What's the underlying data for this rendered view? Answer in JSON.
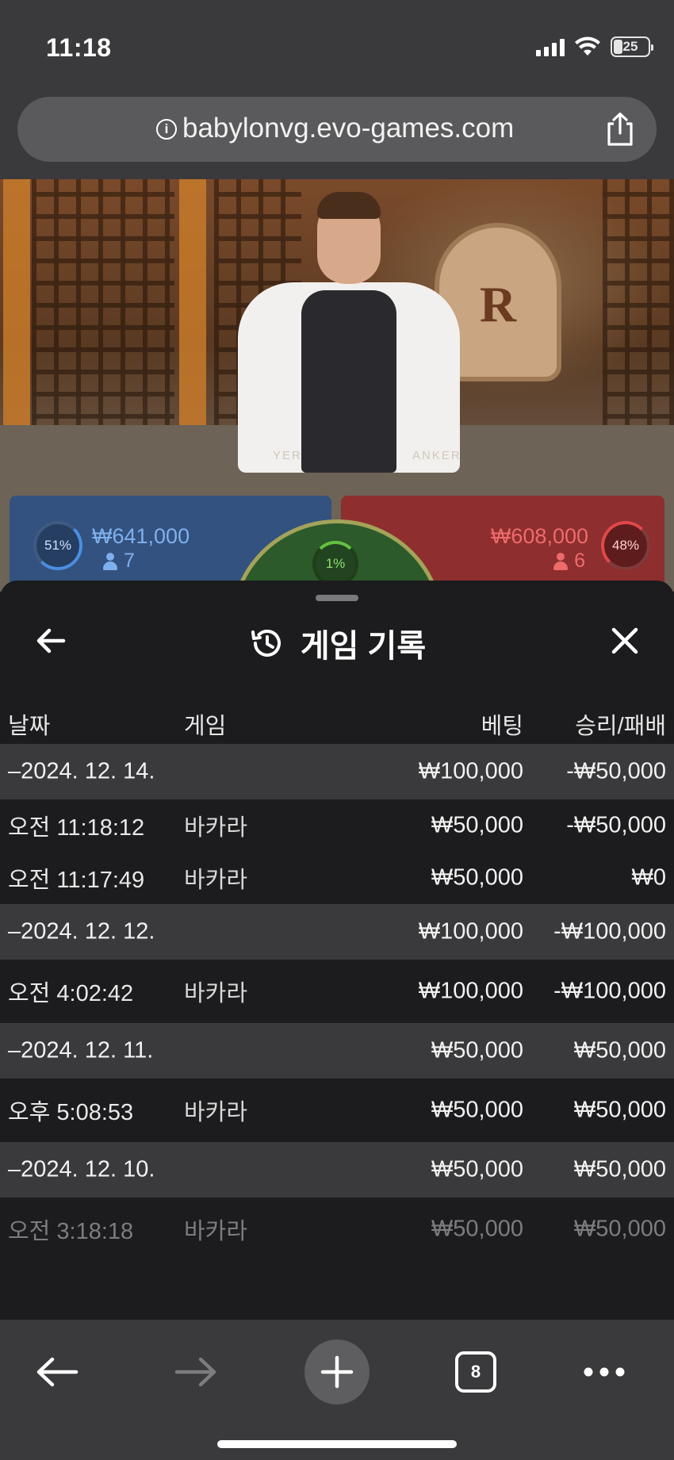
{
  "status_bar": {
    "time": "11:18",
    "battery_level": "25"
  },
  "browser": {
    "url": "babylonvg.evo-games.com",
    "open_tabs": "8"
  },
  "video": {
    "table_text_player": "YER",
    "table_text_banker": "ANKER"
  },
  "bets": {
    "player": {
      "percent": "51%",
      "amount": "₩641,000",
      "players": "7",
      "color": "#33527f"
    },
    "tie": {
      "percent": "1%",
      "color": "#2d5a2a"
    },
    "banker": {
      "percent": "48%",
      "amount": "₩608,000",
      "players": "6",
      "color": "#8e2e2e"
    }
  },
  "history": {
    "title": "게임 기록",
    "columns": {
      "date": "날짜",
      "game": "게임",
      "bet": "베팅",
      "result": "승리/패배"
    },
    "rows": [
      {
        "date": "–2024. 12. 14.",
        "game": "",
        "bet": "₩100,000",
        "result": "-₩50,000"
      },
      {
        "date": "오전 11:18:12",
        "game": "바카라",
        "bet": "₩50,000",
        "result": "-₩50,000"
      },
      {
        "date": "오전 11:17:49",
        "game": "바카라",
        "bet": "₩50,000",
        "result": "₩0"
      },
      {
        "date": "–2024. 12. 12.",
        "game": "",
        "bet": "₩100,000",
        "result": "-₩100,000"
      },
      {
        "date": "오전 4:02:42",
        "game": "바카라",
        "bet": "₩100,000",
        "result": "-₩100,000"
      },
      {
        "date": "–2024. 12. 11.",
        "game": "",
        "bet": "₩50,000",
        "result": "₩50,000"
      },
      {
        "date": "오후 5:08:53",
        "game": "바카라",
        "bet": "₩50,000",
        "result": "₩50,000"
      },
      {
        "date": "–2024. 12. 10.",
        "game": "",
        "bet": "₩50,000",
        "result": "₩50,000"
      },
      {
        "date": "오전 3:18:18",
        "game": "바카라",
        "bet": "₩50,000",
        "result": "₩50,000"
      }
    ]
  },
  "icons": {
    "status": [
      "signal-icon",
      "wifi-icon",
      "battery-icon"
    ],
    "browser": [
      "info-icon",
      "share-icon"
    ],
    "sheet": [
      "back-arrow-icon",
      "history-icon",
      "close-icon"
    ],
    "toolbar": [
      "back-arrow-icon",
      "forward-arrow-icon",
      "plus-icon",
      "tabs-icon",
      "more-icon"
    ]
  }
}
